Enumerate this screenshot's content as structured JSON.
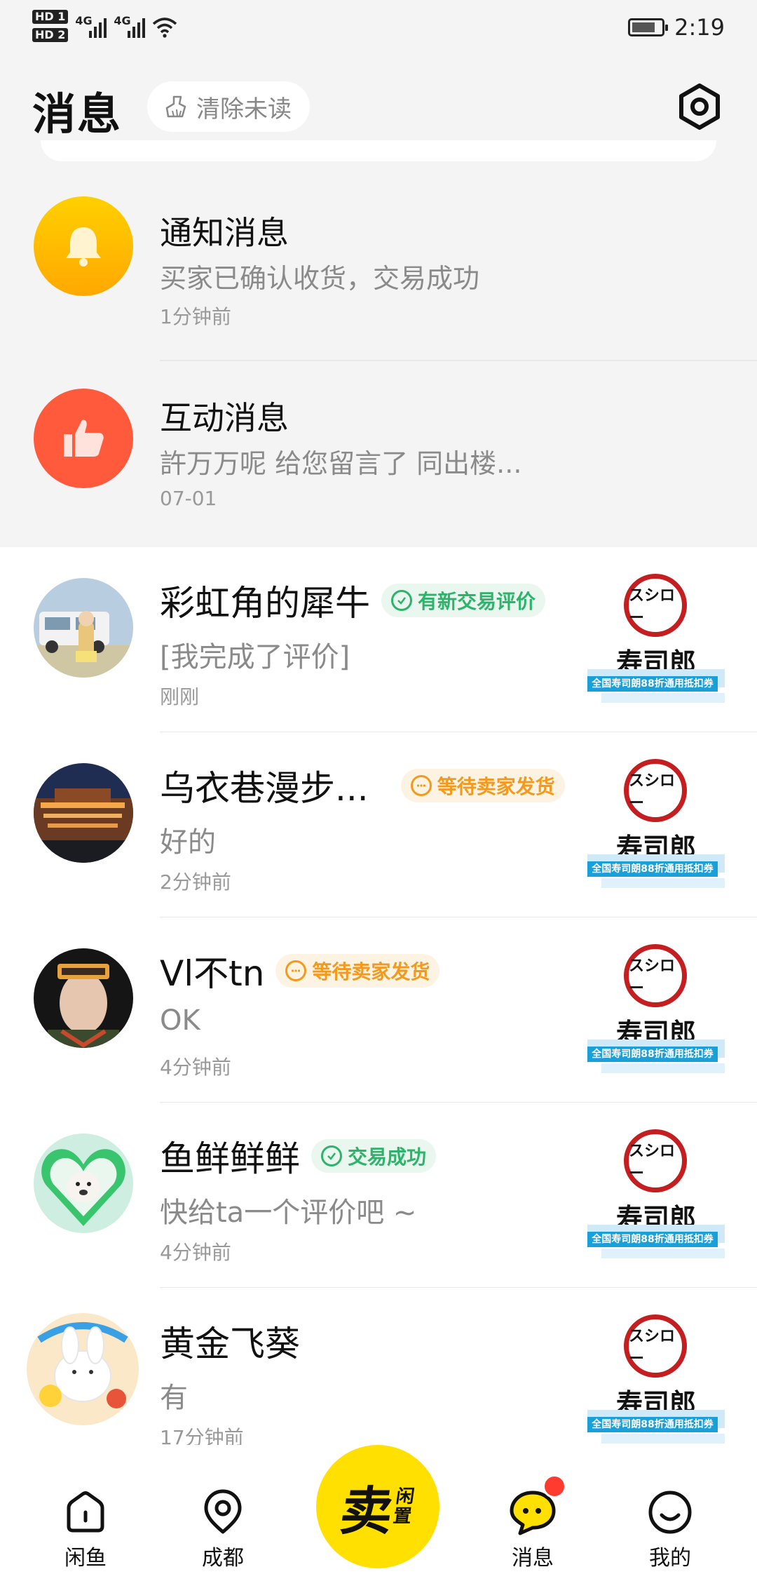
{
  "status_bar": {
    "hd1": "HD 1",
    "hd2": "HD 2",
    "net1": "4G",
    "net2": "4G",
    "time": "2:19"
  },
  "header": {
    "title": "消息",
    "clear_unread": "清除未读",
    "settings_icon": "settings-hexagon-icon"
  },
  "system_messages": [
    {
      "title": "通知消息",
      "preview": "买家已确认收货，交易成功",
      "time": "1分钟前",
      "icon": "bell-icon",
      "color": "#ffc000"
    },
    {
      "title": "互动消息",
      "preview": "許万万呢 给您留言了 同出楼...",
      "time": "07-01",
      "icon": "thumbs-up-icon",
      "color": "#ff5a3c"
    }
  ],
  "chats": [
    {
      "name": "彩虹角的犀牛",
      "badge": "有新交易评价",
      "badge_type": "success",
      "preview": "[我完成了评价]",
      "time": "刚刚"
    },
    {
      "name": "乌衣巷漫步...",
      "badge": "等待卖家发货",
      "badge_type": "pending",
      "preview": "好的",
      "time": "2分钟前"
    },
    {
      "name": "Vl不tn",
      "badge": "等待卖家发货",
      "badge_type": "pending",
      "preview": "OK",
      "time": "4分钟前"
    },
    {
      "name": "鱼鲜鲜鲜",
      "badge": "交易成功",
      "badge_type": "success",
      "preview": "快给ta一个评价吧 ~",
      "time": "4分钟前"
    },
    {
      "name": "黄金飞葵",
      "badge": "",
      "badge_type": "",
      "preview": "有",
      "time": "17分钟前"
    }
  ],
  "product_thumb": {
    "logo_text": "スシロー",
    "brand": "寿司郎",
    "banner": "全国寿司朗88折通用抵扣券"
  },
  "colors": {
    "success_text": "#2db36b",
    "success_bg": "#eaf7ef",
    "pending_text": "#f39a1d",
    "pending_bg": "#fdf3e3",
    "accent_yellow": "#ffe000"
  },
  "bottom_nav": {
    "home": "闲鱼",
    "location": "成都",
    "sell_main": "卖",
    "sell_sub": "闲置",
    "messages": "消息",
    "mine": "我的"
  }
}
